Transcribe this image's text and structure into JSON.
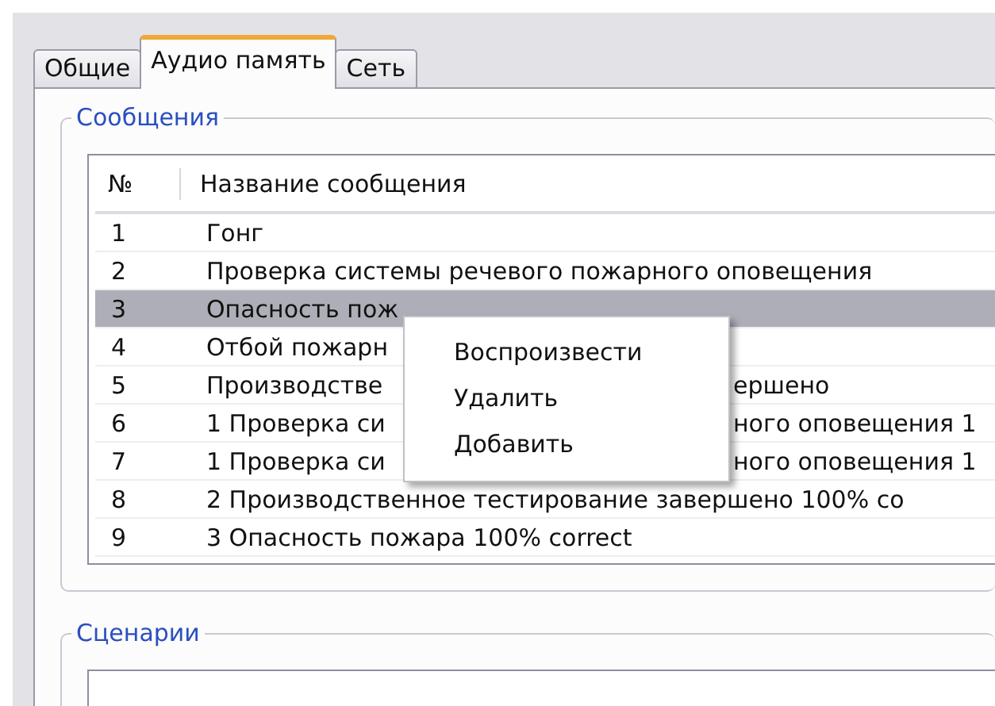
{
  "tabs": [
    {
      "label": "Общие",
      "selected": false
    },
    {
      "label": "Аудио память",
      "selected": true
    },
    {
      "label": "Сеть",
      "selected": false
    }
  ],
  "messages": {
    "title": "Сообщения",
    "columns": [
      "№",
      "Название сообщения"
    ],
    "rows": [
      {
        "number": "1",
        "name": "Гонг",
        "selected": false
      },
      {
        "number": "2",
        "name": "Проверка системы речевого пожарного оповещения",
        "selected": false
      },
      {
        "number": "3",
        "name": "Опасность пож",
        "selected": true
      },
      {
        "number": "4",
        "name": "Отбой пожарн",
        "selected": false
      },
      {
        "number": "5",
        "name": "Производстве",
        "name_tail": "ершено",
        "selected": false
      },
      {
        "number": "6",
        "name": "1 Проверка си",
        "name_tail": "ного оповещения 1",
        "selected": false
      },
      {
        "number": "7",
        "name": "1 Проверка си",
        "name_tail": "ного оповещения 1",
        "selected": false
      },
      {
        "number": "8",
        "name": "2 Производственное тестирование завершено 100% co",
        "selected": false
      },
      {
        "number": "9",
        "name": "3 Опасность пожара 100% correct",
        "selected": false
      }
    ]
  },
  "context_menu": {
    "items": [
      "Воспроизвести",
      "Удалить",
      "Добавить"
    ]
  },
  "scenarios": {
    "title": "Сценарии"
  }
}
